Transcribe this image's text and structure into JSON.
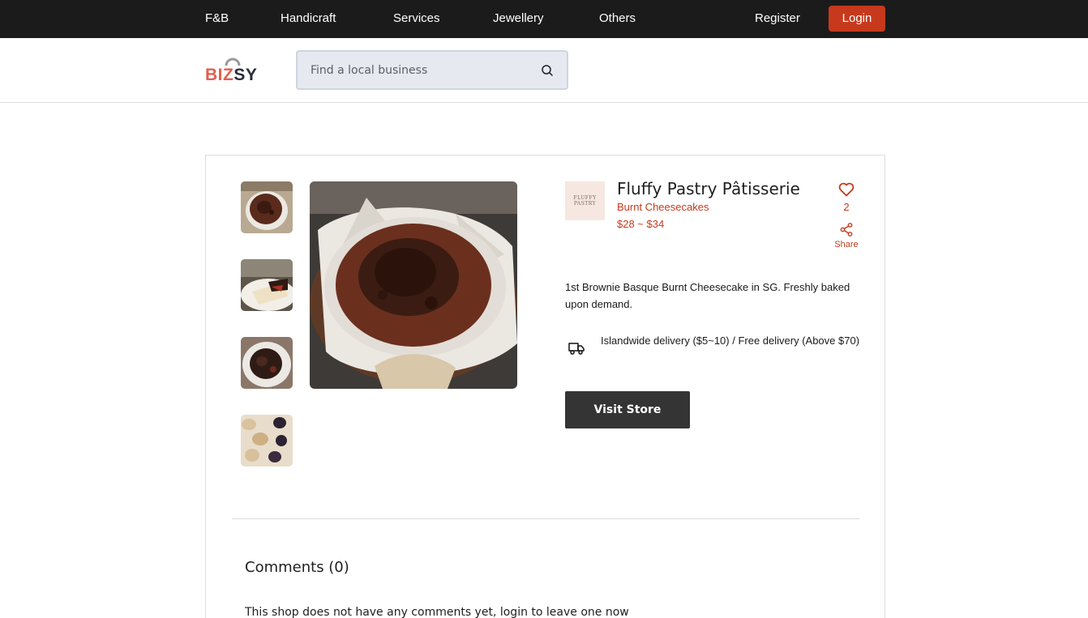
{
  "nav": {
    "categories": [
      "F&B",
      "Handicraft",
      "Services",
      "Jewellery",
      "Others"
    ],
    "register": "Register",
    "login": "Login"
  },
  "header": {
    "logo_text": "BIZSY",
    "logo_biz": "BIZ",
    "logo_sy": "SY",
    "search_placeholder": "Find a local business"
  },
  "listing": {
    "shop_logo_text": [
      "FLUFFY",
      "PASTRY"
    ],
    "shop_name": "Fluffy Pastry Pâtisserie",
    "category": "Burnt Cheesecakes",
    "price": "$28 ~ $34",
    "likes": "2",
    "share": "Share",
    "description": "1st Brownie Basque Burnt Cheesecake in SG. Freshly baked upon demand.",
    "delivery": "Islandwide delivery ($5~10) / Free delivery (Above $70)",
    "visit_button": "Visit Store"
  },
  "comments": {
    "title": "Comments (0)",
    "empty_message": "This shop does not have any comments yet, login to leave one now"
  },
  "colors": {
    "accent": "#c7391c",
    "topbar": "#1b1b1b",
    "button_dark": "#343434",
    "logo_red": "#e35d4f"
  }
}
